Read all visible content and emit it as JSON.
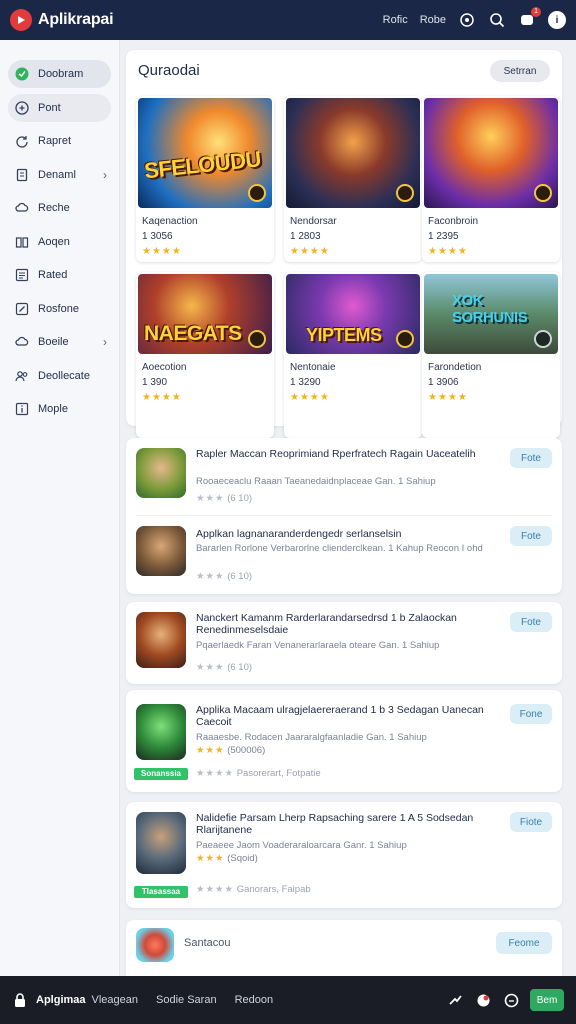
{
  "header": {
    "brand": "Aplikrapai",
    "links": [
      "Rofic",
      "Robe"
    ],
    "notification_count": "1",
    "avatar_initial": "i"
  },
  "sidebar": {
    "items": [
      {
        "label": "Doobram",
        "icon": "globe-icon"
      },
      {
        "label": "Pont",
        "icon": "plus-icon"
      },
      {
        "label": "Rapret",
        "icon": "refresh-icon"
      },
      {
        "label": "Denaml",
        "icon": "document-icon"
      },
      {
        "label": "Reche",
        "icon": "cloud-icon"
      },
      {
        "label": "Aoqen",
        "icon": "book-icon"
      },
      {
        "label": "Rated",
        "icon": "list-icon"
      },
      {
        "label": "Rosfone",
        "icon": "edit-icon"
      },
      {
        "label": "Boeile",
        "icon": "cloud-icon"
      },
      {
        "label": "Deollecate",
        "icon": "people-icon"
      },
      {
        "label": "Mople",
        "icon": "info-icon"
      }
    ]
  },
  "featured": {
    "title": "Quraodai",
    "see_all": "Setrran",
    "tiles": [
      {
        "art_text": "SFELOUDU",
        "name": "Kaqenaction",
        "count": "1 3056",
        "stars": "★★★★"
      },
      {
        "art_text": "",
        "name": "Nendorsar",
        "count": "1 2803",
        "stars": "★★★★"
      },
      {
        "art_text": "",
        "name": "Faconbroin",
        "count": "1 2395",
        "stars": "★★★★"
      },
      {
        "art_text": "NAEGATS",
        "name": "Aoecotion",
        "count": "1 390",
        "stars": "★★★★"
      },
      {
        "art_text": "YIPTEMS",
        "name": "Nentonaie",
        "count": "1 3290",
        "stars": "★★★★"
      },
      {
        "art_text": "XOK SORHUNIS",
        "name": "Farondetion",
        "count": "1 3906",
        "stars": "★★★★"
      }
    ]
  },
  "apps": [
    {
      "title": "Rapler Maccan Reoprimiand Rperfratech Ragain Uaceatelih",
      "desc": "Rooaeceaclu Raaan Taeanedaidnplaceae Gan. 1 Sahiup",
      "rating": "(6 10)",
      "get": "Fote"
    },
    {
      "title": "Applkan lagnanaranderdengedr serlanselsin",
      "desc": "Bararlen Rorlone Verbarorlne clienderclkean. 1 Kahup Reocon I ohd",
      "rating": "(6 10)",
      "get": "Fote"
    },
    {
      "title": "Nanckert Kamanm Rarderlarandarsedrsd 1 b Zalaockan Renedinmeselsdaie",
      "desc": "Pqaerlaedk Faran Venanerarlaraela oteare Gan. 1 Sahiup",
      "rating": "(6 10)",
      "get": "Fote"
    },
    {
      "title": "Applika Macaam ulragjelaereraerand 1 b 3 Sedagan Uanecan Caecoit",
      "desc": "Raaaesbe. Rodacen Jaararalgfaanladie Gan. 1 Sahiup",
      "rating": "(500006)",
      "badge": "Sonanssia",
      "rating2": "Pasorerart, Fotpatie",
      "get": "Fone"
    },
    {
      "title": "Nalidefie Parsam Lherp Rapsaching sarere 1 A 5 Sodsedan Rlarijtanene",
      "desc": "Paeaeee Jaom Voaderaraloarcara Ganr. 1 Sahiup",
      "rating": "(Sqoid)",
      "badge": "Tlasassaa",
      "rating2": "Ganorars, Faipab",
      "get": "Fiote"
    },
    {
      "title": "Santacou",
      "desc": "",
      "rating": "",
      "get": "Feome"
    }
  ],
  "bottombar": {
    "brand": "Aplgimaa",
    "links": [
      "Vleagean",
      "Sodie Saran",
      "Redoon"
    ],
    "button": "Bem"
  }
}
